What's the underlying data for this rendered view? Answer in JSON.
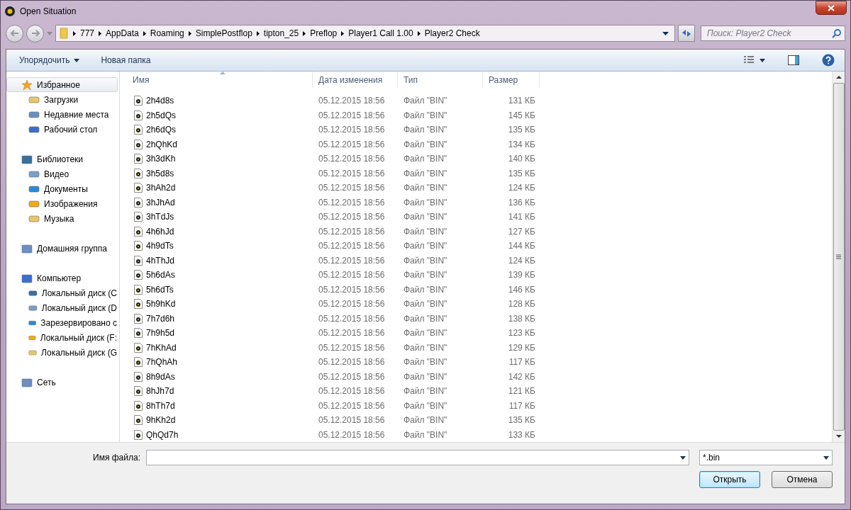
{
  "window": {
    "title": "Open Situation"
  },
  "breadcrumb": [
    "777",
    "AppData",
    "Roaming",
    "SimplePostflop",
    "tipton_25",
    "Preflop",
    "Player1 Call 1.00",
    "Player2 Check"
  ],
  "search": {
    "placeholder": "Поиск: Player2 Check"
  },
  "toolbar": {
    "organize": "Упорядочить",
    "new_folder": "Новая папка"
  },
  "sidebar": {
    "groups": [
      {
        "label": "Избранное",
        "selected": true,
        "children": [
          {
            "label": "Загрузки",
            "selected": false
          },
          {
            "label": "Недавние места",
            "selected": false
          },
          {
            "label": "Рабочий стол",
            "selected": false
          }
        ]
      },
      {
        "label": "Библиотеки",
        "selected": false,
        "children": [
          {
            "label": "Видео",
            "selected": false
          },
          {
            "label": "Документы",
            "selected": false
          },
          {
            "label": "Изображения",
            "selected": false
          },
          {
            "label": "Музыка",
            "selected": false
          }
        ]
      },
      {
        "label": "Домашняя группа",
        "selected": false
      },
      {
        "label": "Компьютер",
        "selected": false,
        "children": [
          {
            "label": "Локальный диск (C",
            "selected": false
          },
          {
            "label": "Локальный диск (D",
            "selected": false
          },
          {
            "label": "Зарезервировано с",
            "selected": false
          },
          {
            "label": "Локальный диск (F:",
            "selected": false
          },
          {
            "label": "Локальный диск (G",
            "selected": false
          }
        ]
      },
      {
        "label": "Сеть",
        "selected": false
      }
    ]
  },
  "table": {
    "columns": [
      {
        "label": "Имя",
        "sorted": true
      },
      {
        "label": "Дата изменения",
        "sorted": false
      },
      {
        "label": "Тип",
        "sorted": false
      },
      {
        "label": "Размер",
        "sorted": false
      }
    ],
    "rows": [
      [
        "2h4d8s",
        "05.12.2015 18:56",
        "Файл \"BIN\"",
        "131 КБ"
      ],
      [
        "2h5dQs",
        "05.12.2015 18:56",
        "Файл \"BIN\"",
        "145 КБ"
      ],
      [
        "2h6dQs",
        "05.12.2015 18:56",
        "Файл \"BIN\"",
        "135 КБ"
      ],
      [
        "2hQhKd",
        "05.12.2015 18:56",
        "Файл \"BIN\"",
        "134 КБ"
      ],
      [
        "3h3dKh",
        "05.12.2015 18:56",
        "Файл \"BIN\"",
        "140 КБ"
      ],
      [
        "3h5d8s",
        "05.12.2015 18:56",
        "Файл \"BIN\"",
        "135 КБ"
      ],
      [
        "3hAh2d",
        "05.12.2015 18:56",
        "Файл \"BIN\"",
        "124 КБ"
      ],
      [
        "3hJhAd",
        "05.12.2015 18:56",
        "Файл \"BIN\"",
        "136 КБ"
      ],
      [
        "3hTdJs",
        "05.12.2015 18:56",
        "Файл \"BIN\"",
        "141 КБ"
      ],
      [
        "4h6hJd",
        "05.12.2015 18:56",
        "Файл \"BIN\"",
        "127 КБ"
      ],
      [
        "4h9dTs",
        "05.12.2015 18:56",
        "Файл \"BIN\"",
        "144 КБ"
      ],
      [
        "4hThJd",
        "05.12.2015 18:56",
        "Файл \"BIN\"",
        "124 КБ"
      ],
      [
        "5h6dAs",
        "05.12.2015 18:56",
        "Файл \"BIN\"",
        "139 КБ"
      ],
      [
        "5h6dTs",
        "05.12.2015 18:56",
        "Файл \"BIN\"",
        "146 КБ"
      ],
      [
        "5h9hKd",
        "05.12.2015 18:56",
        "Файл \"BIN\"",
        "128 КБ"
      ],
      [
        "7h7d6h",
        "05.12.2015 18:56",
        "Файл \"BIN\"",
        "138 КБ"
      ],
      [
        "7h9h5d",
        "05.12.2015 18:56",
        "Файл \"BIN\"",
        "123 КБ"
      ],
      [
        "7hKhAd",
        "05.12.2015 18:56",
        "Файл \"BIN\"",
        "129 КБ"
      ],
      [
        "7hQhAh",
        "05.12.2015 18:56",
        "Файл \"BIN\"",
        "117 КБ"
      ],
      [
        "8h9dAs",
        "05.12.2015 18:56",
        "Файл \"BIN\"",
        "142 КБ"
      ],
      [
        "8hJh7d",
        "05.12.2015 18:56",
        "Файл \"BIN\"",
        "121 КБ"
      ],
      [
        "8hTh7d",
        "05.12.2015 18:56",
        "Файл \"BIN\"",
        "117 КБ"
      ],
      [
        "9hKh2d",
        "05.12.2015 18:56",
        "Файл \"BIN\"",
        "135 КБ"
      ],
      [
        "QhQd7h",
        "05.12.2015 18:56",
        "Файл \"BIN\"",
        "133 КБ"
      ]
    ]
  },
  "footer": {
    "filename_label": "Имя файла:",
    "filter": "*.bin",
    "buttons": [
      {
        "label": "Открыть",
        "default": true
      },
      {
        "label": "Отмена",
        "default": false
      }
    ]
  }
}
